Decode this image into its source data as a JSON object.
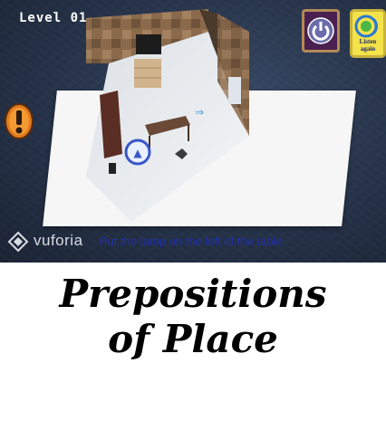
{
  "hud": {
    "level": "Level 01",
    "restart_icon": "restart-icon",
    "listen_icon": "speaker-icon",
    "listen_label": "Listen again",
    "hint_icon": "exclamation-icon",
    "accent": "#e07b1f"
  },
  "branding": {
    "name": "vuforia"
  },
  "instruction": "Put the lamp on the left of the table",
  "title": {
    "line1": "Prepositions",
    "line2": "of Place"
  }
}
